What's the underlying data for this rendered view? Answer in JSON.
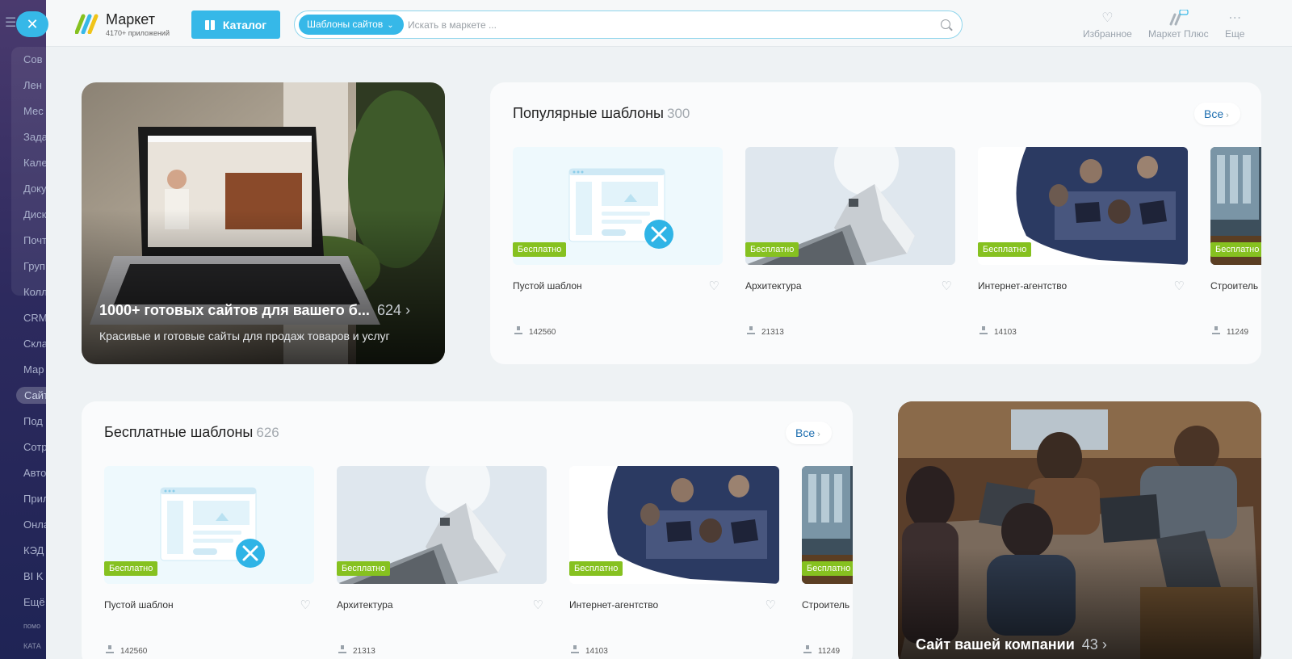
{
  "sidebar": {
    "items": [
      "Сов",
      "Лен",
      "Мес",
      "Зада",
      "Кале",
      "Доку",
      "Диск",
      "Почт",
      "Груп",
      "Колл",
      "CRM",
      "Скла",
      "Мар",
      "Сайт",
      "Под",
      "Сотр",
      "Авто",
      "Прил",
      "Онла",
      "КЭД",
      "BI K",
      "Ещё"
    ],
    "active_index": 13,
    "footer": [
      "помо",
      "КАТА"
    ]
  },
  "close_button": {
    "icon": "close-icon",
    "glyph": "✕"
  },
  "header": {
    "logo_title": "Маркет",
    "logo_subtitle": "4170+ приложений",
    "catalog_label": "Каталог",
    "search": {
      "scope_label": "Шаблоны сайтов",
      "placeholder": "Искать в маркете ..."
    },
    "actions": [
      {
        "label": "Избранное",
        "icon": "heart-icon"
      },
      {
        "label": "Маркет Плюс",
        "icon": "market-plus-icon"
      },
      {
        "label": "Еще",
        "icon": "more-icon"
      }
    ]
  },
  "promo_sites": {
    "title": "1000+ готовых сайтов для вашего б...",
    "count": "624",
    "description": "Красивые и готовые сайты для продаж товаров и услуг"
  },
  "popular": {
    "title": "Популярные шаблоны",
    "count": "300",
    "all_label": "Все",
    "items": [
      {
        "name": "Пустой шаблон",
        "badge": "Бесплатно",
        "downloads": "142560"
      },
      {
        "name": "Архитектура",
        "badge": "Бесплатно",
        "downloads": "21313"
      },
      {
        "name": "Интернет-агентство",
        "badge": "Бесплатно",
        "downloads": "14103"
      },
      {
        "name": "Строитель",
        "badge": "Бесплатно",
        "downloads": "11249"
      }
    ]
  },
  "free": {
    "title": "Бесплатные шаблоны",
    "count": "626",
    "all_label": "Все",
    "items": [
      {
        "name": "Пустой шаблон",
        "badge": "Бесплатно",
        "downloads": "142560"
      },
      {
        "name": "Архитектура",
        "badge": "Бесплатно",
        "downloads": "21313"
      },
      {
        "name": "Интернет-агентство",
        "badge": "Бесплатно",
        "downloads": "14103"
      },
      {
        "name": "Строитель",
        "badge": "Бесплатно",
        "downloads": "11249"
      }
    ]
  },
  "promo_company": {
    "title": "Сайт вашей компании",
    "count": "43"
  },
  "colors": {
    "accent": "#36b8e8",
    "badge": "#86c120",
    "link": "#1f6fb0",
    "sidebar": "#2d2a5e"
  }
}
